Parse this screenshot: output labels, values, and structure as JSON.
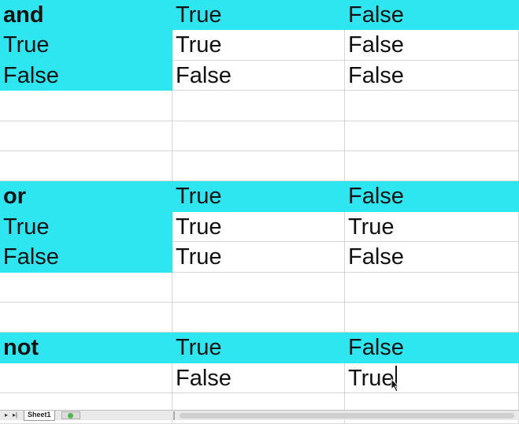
{
  "tables": {
    "and": {
      "header": [
        "and",
        "True",
        "False"
      ],
      "rows": [
        [
          "True",
          "True",
          "False"
        ],
        [
          "False",
          "False",
          "False"
        ]
      ]
    },
    "or": {
      "header": [
        "or",
        "True",
        "False"
      ],
      "rows": [
        [
          "True",
          "True",
          "True"
        ],
        [
          "False",
          "True",
          "False"
        ]
      ]
    },
    "not": {
      "header": [
        "not",
        "True",
        "False"
      ],
      "rows": [
        [
          "",
          "False",
          "True"
        ]
      ]
    }
  },
  "tabbar": {
    "sheet_tab": "Sheet1"
  },
  "colors": {
    "highlight": "#2ee6f0"
  }
}
